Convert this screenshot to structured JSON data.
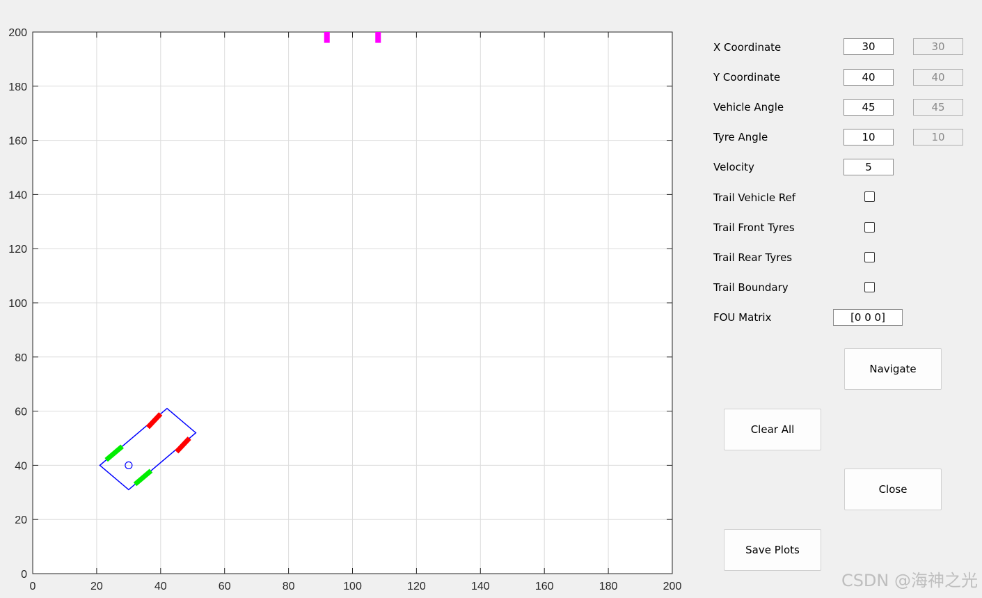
{
  "plot": {
    "x_ticks": [
      0,
      20,
      40,
      60,
      80,
      100,
      120,
      140,
      160,
      180,
      200
    ],
    "y_ticks": [
      0,
      20,
      40,
      60,
      80,
      100,
      120,
      140,
      160,
      180,
      200
    ],
    "xlim": [
      0,
      200
    ],
    "ylim": [
      0,
      200
    ],
    "grid": true,
    "colors": {
      "boundary": "#0000ff",
      "front_tyres": "#ff0000",
      "rear_tyres": "#00ee00",
      "markers": "#ff00ff"
    },
    "vehicle": {
      "ref_point": [
        30,
        40
      ],
      "boundary": [
        [
          21,
          40
        ],
        [
          30,
          31
        ],
        [
          51,
          52
        ],
        [
          42,
          61
        ]
      ],
      "front_tyres": [
        [
          [
            36,
            54
          ],
          [
            40,
            59
          ]
        ],
        [
          [
            45,
            45
          ],
          [
            49,
            50
          ]
        ]
      ],
      "rear_tyres": [
        [
          [
            23,
            42
          ],
          [
            28,
            47
          ]
        ],
        [
          [
            32,
            33
          ],
          [
            37,
            38
          ]
        ]
      ]
    },
    "markers": [
      [
        [
          92,
          196
        ],
        [
          92,
          200
        ]
      ],
      [
        [
          108,
          196
        ],
        [
          108,
          200
        ]
      ]
    ]
  },
  "controls": {
    "x_label": "X Coordinate",
    "x_value": "30",
    "x_display": "30",
    "y_label": "Y Coordinate",
    "y_value": "40",
    "y_display": "40",
    "angle_label": "Vehicle Angle",
    "angle_value": "45",
    "angle_display": "45",
    "tyre_label": "Tyre Angle",
    "tyre_value": "10",
    "tyre_display": "10",
    "velocity_label": "Velocity",
    "velocity_value": "5",
    "trail_ref_label": "Trail Vehicle Ref",
    "trail_front_label": "Trail Front Tyres",
    "trail_rear_label": "Trail Rear Tyres",
    "trail_boundary_label": "Trail Boundary",
    "fou_label": "FOU Matrix",
    "fou_value": "[0 0 0]"
  },
  "buttons": {
    "navigate": "Navigate",
    "clear_all": "Clear All",
    "close": "Close",
    "save_plots": "Save Plots"
  },
  "watermark": "CSDN @海神之光"
}
